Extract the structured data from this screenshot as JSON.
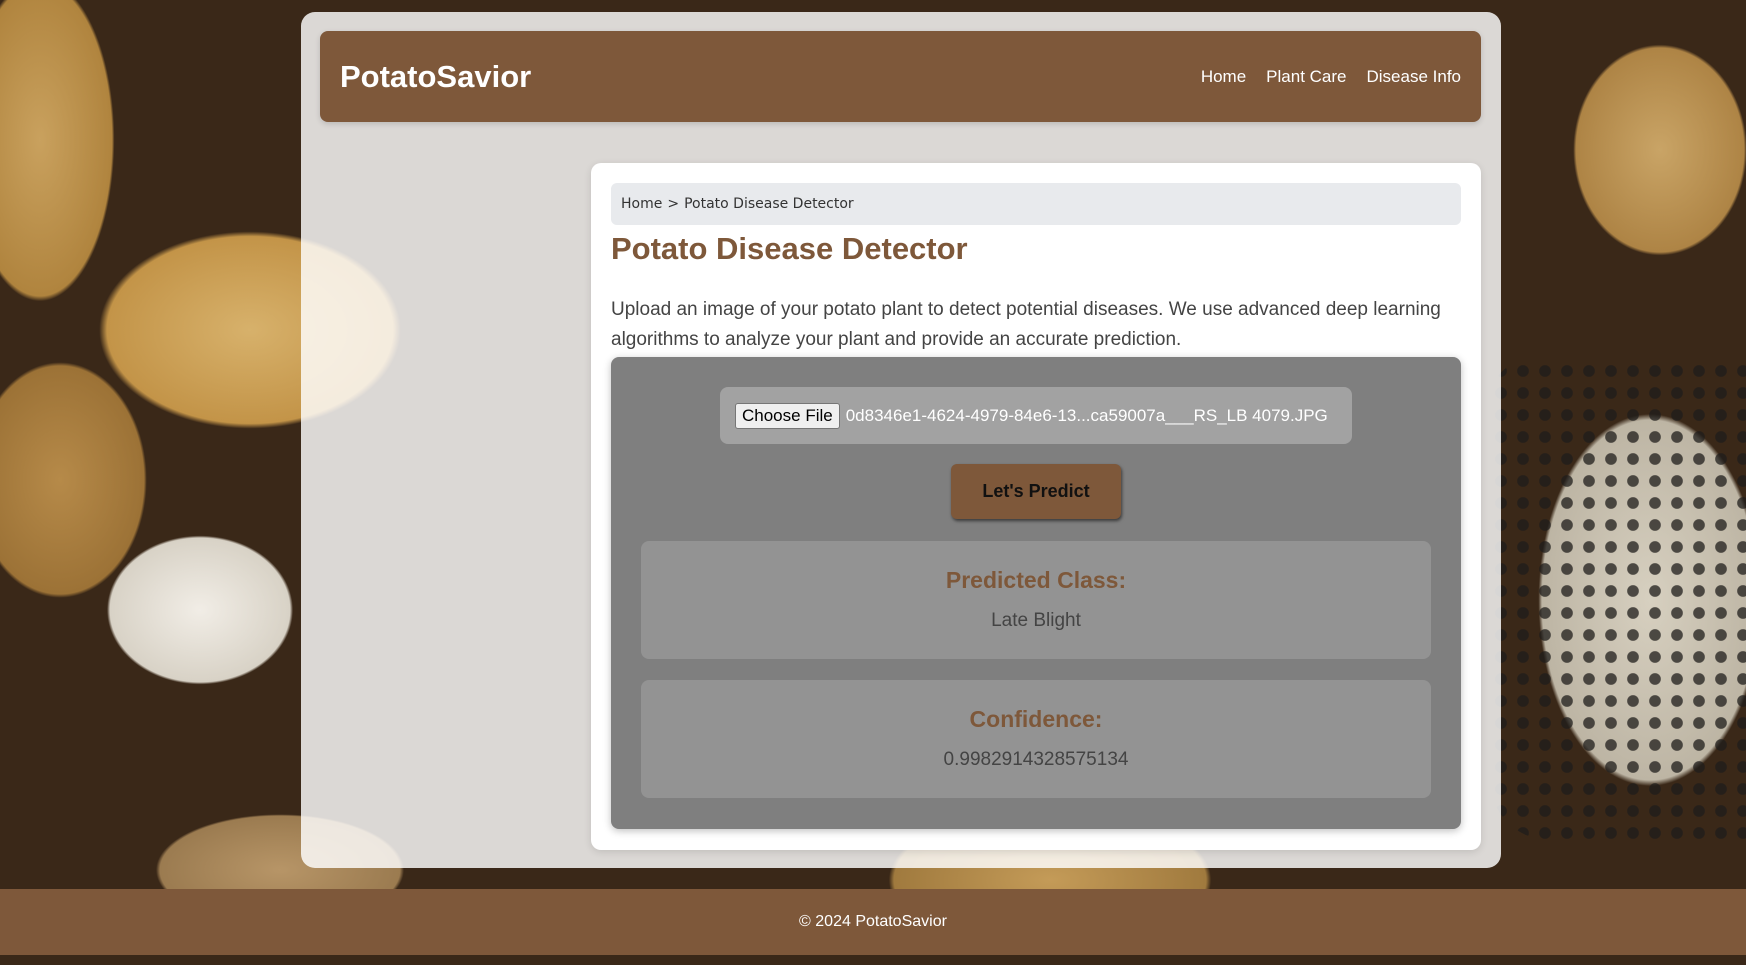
{
  "header": {
    "brand": "PotatoSavior",
    "nav": [
      {
        "label": "Home"
      },
      {
        "label": "Plant Care"
      },
      {
        "label": "Disease Info"
      }
    ]
  },
  "breadcrumb": {
    "home": "Home",
    "separator": ">",
    "current": "Potato Disease Detector"
  },
  "main": {
    "title": "Potato Disease Detector",
    "intro": "Upload an image of your potato plant to detect potential diseases. We use advanced deep learning algorithms to analyze your plant and provide an accurate prediction.",
    "file_input": {
      "button_label": "Choose File",
      "file_name": "0d8346e1-4624-4979-84e6-13...ca59007a___RS_LB 4079.JPG"
    },
    "predict_label": "Let's Predict",
    "result": {
      "class_label": "Predicted Class:",
      "class_value": "Late Blight",
      "confidence_label": "Confidence:",
      "confidence_value": "0.9982914328575134"
    }
  },
  "footer": {
    "text": "© 2024 PotatoSavior"
  },
  "colors": {
    "brand_brown": "#7e583a",
    "panel_gray": "#7f7f7f",
    "result_gray": "#939393"
  }
}
